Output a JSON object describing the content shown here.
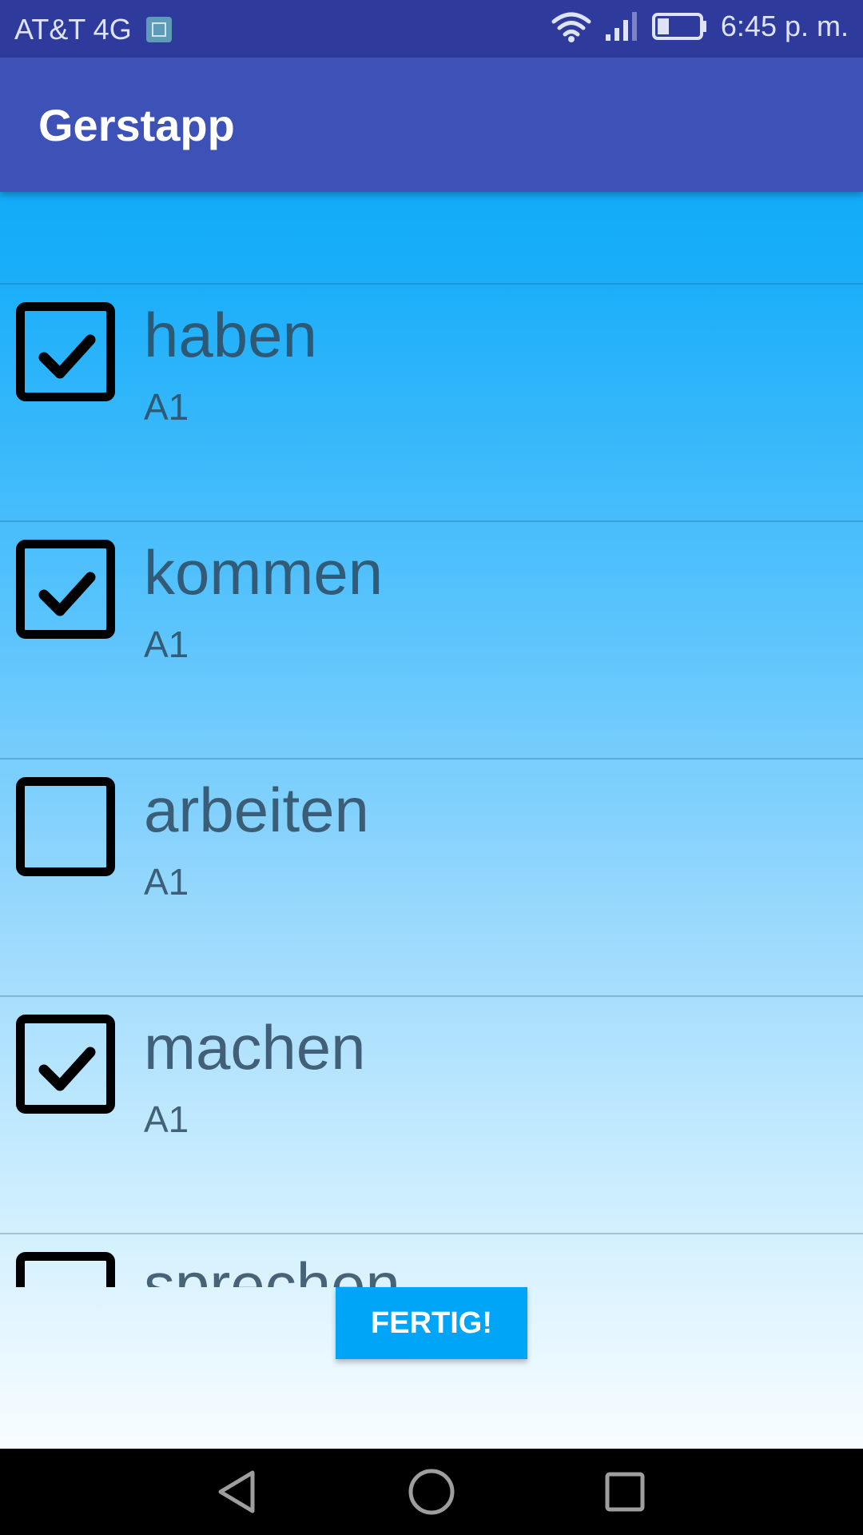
{
  "status_bar": {
    "carrier": "AT&T 4G",
    "time": "6:45 p. m.",
    "icons": [
      "image-notification-icon",
      "wifi-icon",
      "signal-icon",
      "battery-icon"
    ]
  },
  "app_bar": {
    "title": "Gerstapp"
  },
  "list": {
    "items": [
      {
        "word": "haben",
        "level": "A1",
        "checked": true
      },
      {
        "word": "kommen",
        "level": "A1",
        "checked": true
      },
      {
        "word": "arbeiten",
        "level": "A1",
        "checked": false
      },
      {
        "word": "machen",
        "level": "A1",
        "checked": true
      },
      {
        "word": "sprechen",
        "level": "",
        "checked": false
      }
    ]
  },
  "actions": {
    "done_label": "FERTIG!"
  },
  "nav_bar": {
    "icons": [
      "back-icon",
      "home-icon",
      "recents-icon"
    ]
  },
  "colors": {
    "status_bar": "#2f3b9c",
    "app_bar": "#3e51b6",
    "accent": "#00a5f8"
  }
}
